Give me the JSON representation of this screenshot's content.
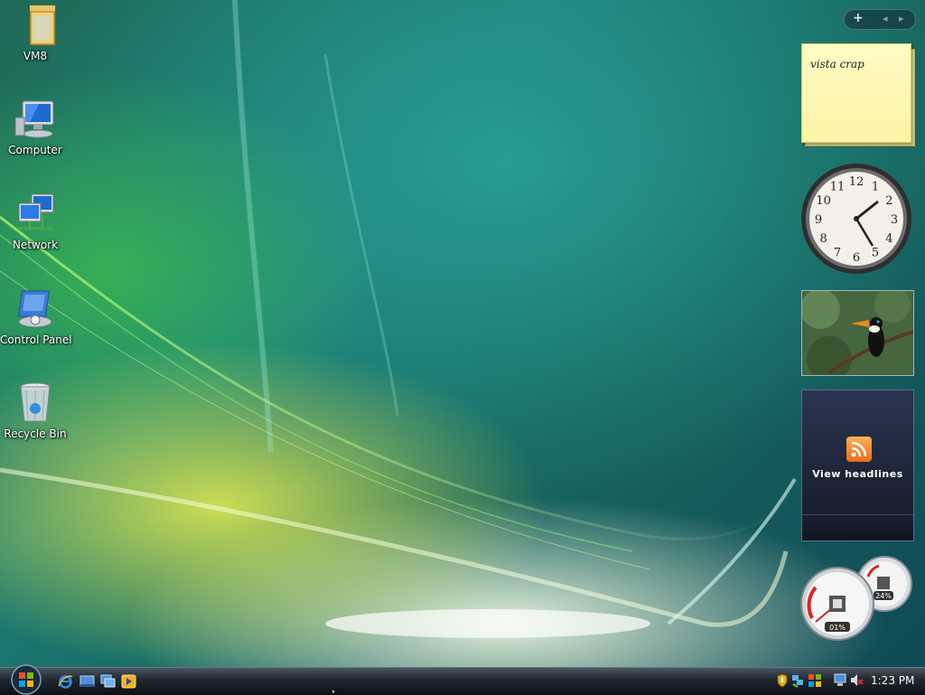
{
  "desktop_icons": [
    {
      "id": "vm8",
      "label": "VM8",
      "icon": "folder-icon"
    },
    {
      "id": "computer",
      "label": "Computer",
      "icon": "computer-icon"
    },
    {
      "id": "network",
      "label": "Network",
      "icon": "network-icon"
    },
    {
      "id": "control-panel",
      "label": "Control Panel",
      "icon": "control-panel-icon"
    },
    {
      "id": "recycle-bin",
      "label": "Recycle Bin",
      "icon": "recycle-bin-icon"
    }
  ],
  "sidebar": {
    "controls": {
      "add": "+",
      "prev": "◂",
      "next": "▸"
    },
    "notes_gadget": {
      "text": "vista crap"
    },
    "clock_gadget": {
      "numerals": [
        "12",
        "1",
        "2",
        "3",
        "4",
        "5",
        "6",
        "7",
        "8",
        "9",
        "10",
        "11"
      ]
    },
    "slideshow_gadget": {
      "subject": "toucan-photo"
    },
    "feed_gadget": {
      "label": "View headlines",
      "icon": "rss-icon"
    },
    "cpu_meter": {
      "cpu_percent": "01%",
      "memory_percent": "24%"
    }
  },
  "taskbar": {
    "start_icon": "windows-orb-icon",
    "quick_launch": [
      "internet-explorer-icon",
      "show-desktop-icon",
      "switch-windows-icon",
      "media-player-icon"
    ],
    "tray_icons": [
      "security-shield-icon",
      "network-tray-icon",
      "updates-icon",
      "network-status-icon",
      "volume-muted-icon"
    ],
    "time": "1:23 PM"
  },
  "colors": {
    "taskbar": "#1a2029",
    "accent": "#ec6a14",
    "note": "#fdf6b0"
  }
}
